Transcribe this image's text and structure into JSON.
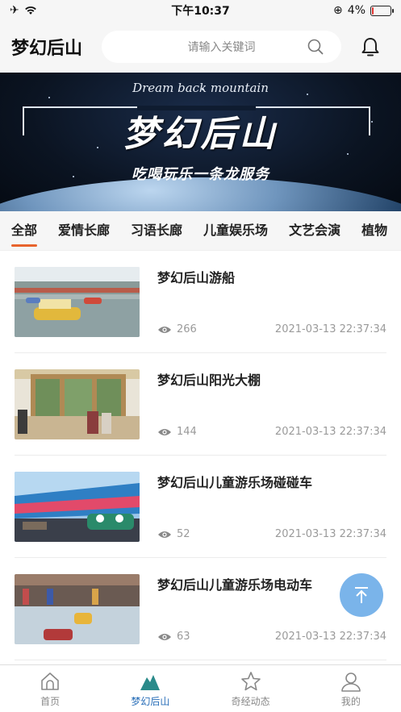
{
  "status_bar": {
    "time": "下午10:37",
    "battery_percent": "4%",
    "battery_level": 0.04
  },
  "header": {
    "title": "梦幻后山",
    "search_placeholder": "请输入关键词"
  },
  "banner": {
    "subtitle_en": "Dream back mountain",
    "title": "梦幻后山",
    "slogan": "吃喝玩乐一条龙服务"
  },
  "tabs": [
    {
      "label": "全部",
      "active": true
    },
    {
      "label": "爱情长廊",
      "active": false
    },
    {
      "label": "习语长廊",
      "active": false
    },
    {
      "label": "儿童娱乐场",
      "active": false
    },
    {
      "label": "文艺会演",
      "active": false
    },
    {
      "label": "植物",
      "active": false
    }
  ],
  "items": [
    {
      "title": "梦幻后山游船",
      "views": "266",
      "date": "2021-03-13 22:37:34"
    },
    {
      "title": "梦幻后山阳光大棚",
      "views": "144",
      "date": "2021-03-13 22:37:34"
    },
    {
      "title": "梦幻后山儿童游乐场碰碰车",
      "views": "52",
      "date": "2021-03-13 22:37:34"
    },
    {
      "title": "梦幻后山儿童游乐场电动车",
      "views": "63",
      "date": "2021-03-13 22:37:34"
    }
  ],
  "bottom_nav": [
    {
      "label": "首页",
      "icon": "home-icon",
      "active": false
    },
    {
      "label": "梦幻后山",
      "icon": "mountain-icon",
      "active": true
    },
    {
      "label": "奇经动态",
      "icon": "star-icon",
      "active": false
    },
    {
      "label": "我的",
      "icon": "user-icon",
      "active": false
    }
  ],
  "colors": {
    "accent": "#e8632c",
    "nav_active": "#2a6fb8",
    "top_button": "#7ab4ea"
  }
}
